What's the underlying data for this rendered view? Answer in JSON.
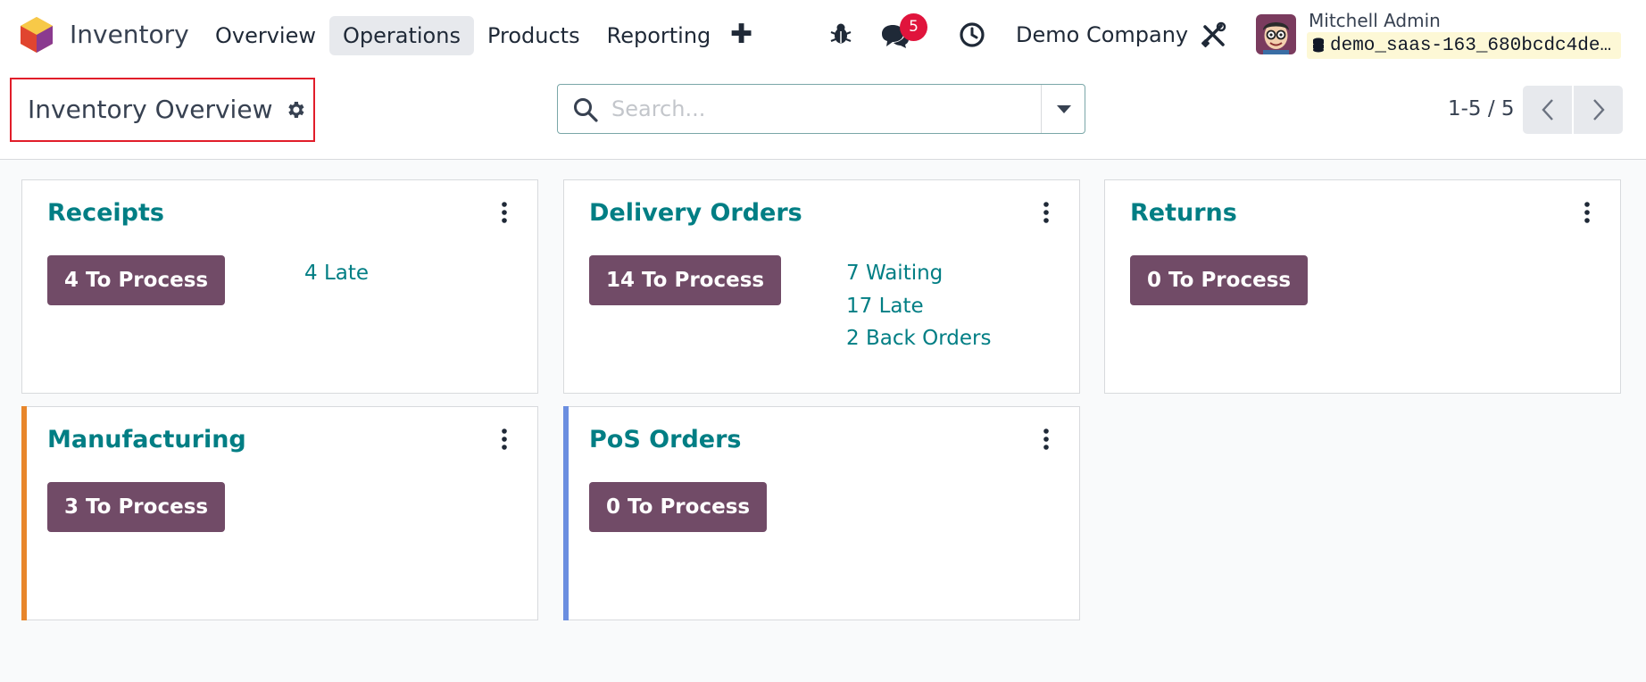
{
  "navbar": {
    "app_name": "Inventory",
    "menu": [
      "Overview",
      "Operations",
      "Products",
      "Reporting"
    ],
    "active_menu": "Operations",
    "message_count": "5",
    "company": "Demo Company",
    "user_name": "Mitchell Admin",
    "database": "demo_saas-163_680bcdc4de…"
  },
  "control": {
    "title": "Inventory Overview",
    "search_placeholder": "Search...",
    "pager": "1-5 / 5"
  },
  "cards": [
    {
      "title": "Receipts",
      "button": "4 To Process",
      "links": [
        "4 Late"
      ],
      "accent": ""
    },
    {
      "title": "Delivery Orders",
      "button": "14 To Process",
      "links": [
        "7 Waiting",
        "17 Late",
        "2 Back Orders"
      ],
      "accent": ""
    },
    {
      "title": "Returns",
      "button": "0 To Process",
      "links": [],
      "accent": ""
    },
    {
      "title": "Manufacturing",
      "button": "3 To Process",
      "links": [],
      "accent": "#e8862b"
    },
    {
      "title": "PoS Orders",
      "button": "0 To Process",
      "links": [],
      "accent": "#6b8ee0"
    }
  ],
  "colors": {
    "brand": "#714b67",
    "link": "#017e84",
    "badge": "#e0143c",
    "highlight_border": "#e11d2a"
  },
  "icons": [
    "bug-icon",
    "chat-icon",
    "clock-icon",
    "tools-icon",
    "gear-icon",
    "search-icon",
    "chevron-left-icon",
    "chevron-right-icon",
    "kebab-menu-icon",
    "database-icon"
  ]
}
